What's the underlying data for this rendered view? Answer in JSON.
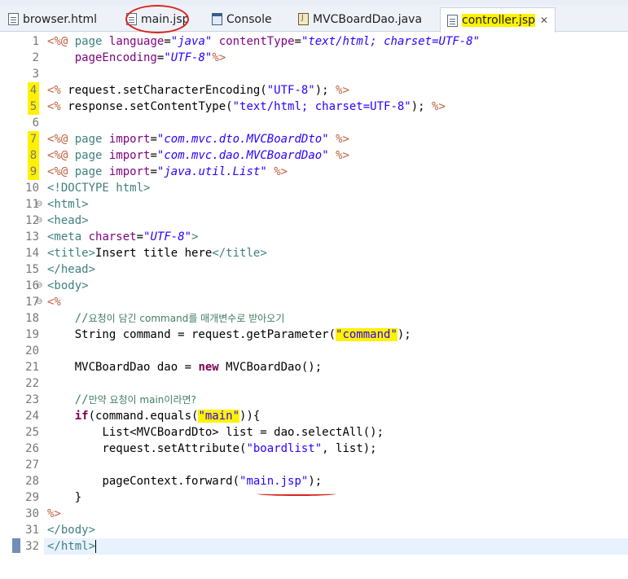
{
  "tabs": [
    {
      "label": "browser.html",
      "icon": "html-file-icon",
      "active": false,
      "highlighted": false
    },
    {
      "label": "main.jsp",
      "icon": "jsp-file-icon",
      "active": false,
      "highlighted": false
    },
    {
      "label": "Console",
      "icon": "console-icon",
      "active": false,
      "highlighted": false
    },
    {
      "label": "MVCBoardDao.java",
      "icon": "java-file-icon",
      "active": false,
      "highlighted": false
    },
    {
      "label": "controller.jsp",
      "icon": "jsp-file-icon",
      "active": true,
      "highlighted": true
    }
  ],
  "close_label": "✕",
  "colors": {
    "directive": "#bf5f3f",
    "attribute": "#7f007f",
    "string": "#2a00ff",
    "tag": "#3f7f7f",
    "keyword": "#7f0055",
    "comment": "#3f7f5f",
    "highlight": "#fff200",
    "annotation": "#d9231b"
  },
  "editor": {
    "lines": [
      {
        "n": "1"
      },
      {
        "n": "2"
      },
      {
        "n": "3"
      },
      {
        "n": "4",
        "marked": true
      },
      {
        "n": "5",
        "marked": true
      },
      {
        "n": "6"
      },
      {
        "n": "7",
        "marked": true
      },
      {
        "n": "8",
        "marked": true
      },
      {
        "n": "9",
        "marked": true
      },
      {
        "n": "10"
      },
      {
        "n": "11",
        "fold": true
      },
      {
        "n": "12",
        "fold": true
      },
      {
        "n": "13"
      },
      {
        "n": "14"
      },
      {
        "n": "15"
      },
      {
        "n": "16",
        "fold": true
      },
      {
        "n": "17",
        "fold": true
      },
      {
        "n": "18"
      },
      {
        "n": "19"
      },
      {
        "n": "20"
      },
      {
        "n": "21"
      },
      {
        "n": "22"
      },
      {
        "n": "23"
      },
      {
        "n": "24"
      },
      {
        "n": "25"
      },
      {
        "n": "26"
      },
      {
        "n": "27"
      },
      {
        "n": "28"
      },
      {
        "n": "29"
      },
      {
        "n": "30"
      },
      {
        "n": "31"
      },
      {
        "n": "32"
      }
    ],
    "t": {
      "open_dir": "<%@",
      "open_sc": "<%",
      "close_dir": "%>",
      "page": "page",
      "import": "import",
      "language_attr": "language",
      "language_val": "\"java\"",
      "ctype_attr": "contentType",
      "ctype_val": "\"text/html; charset=UTF-8\"",
      "penc_attr": "pageEncoding",
      "penc_val": "\"UTF-8\"",
      "l4_a": "request.setCharacterEncoding(",
      "l4_s": "\"UTF-8\"",
      "l4_b": ");",
      "l5_a": "response.setContentType(",
      "l5_s": "\"text/html; charset=UTF-8\"",
      "l5_b": ");",
      "imp1": "\"com.mvc.dto.MVCBoardDto\"",
      "imp2": "\"com.mvc.dao.MVCBoardDao\"",
      "imp3": "\"java.util.List\"",
      "doctype_a": "<!DOCTYPE",
      "doctype_b": "html",
      "doctype_c": ">",
      "html_open": "<html>",
      "head_open": "<head>",
      "meta_a": "<meta",
      "meta_attr": "charset",
      "meta_val": "\"UTF-8\"",
      "meta_b": ">",
      "title_open": "<title>",
      "title_text": "Insert title here",
      "title_close": "</title>",
      "head_close": "</head>",
      "body_open": "<body>",
      "scriptlet_open": "<%",
      "c18_slash": "//",
      "c18_ko1": "요청이 담긴 ",
      "c18_cmd": "command",
      "c18_ko2": "를 매개변수로 받아오기",
      "l19_a": "String command = request.getParameter(",
      "l19_s": "\"command\"",
      "l19_b": ");",
      "l21_a": "MVCBoardDao dao = ",
      "l21_new": "new",
      "l21_b": " MVCBoardDao();",
      "c23_slash": "//",
      "c23_ko1": "만약 요청이 ",
      "c23_main": "main",
      "c23_ko2": "이라면?",
      "l24_if": "if",
      "l24_a": "(command.equals(",
      "l24_s": "\"main\"",
      "l24_b": ")){",
      "l25": "List<MVCBoardDto> list = dao.selectAll();",
      "l26_a": "request.setAttribute(",
      "l26_s": "\"boardlist\"",
      "l26_b": ", list);",
      "l28_a": "pageContext.forward(",
      "l28_s": "\"main.jsp\"",
      "l28_b": ");",
      "l29": "}",
      "l30": "%>",
      "body_close": "</body>",
      "html_close": "</html>"
    }
  }
}
